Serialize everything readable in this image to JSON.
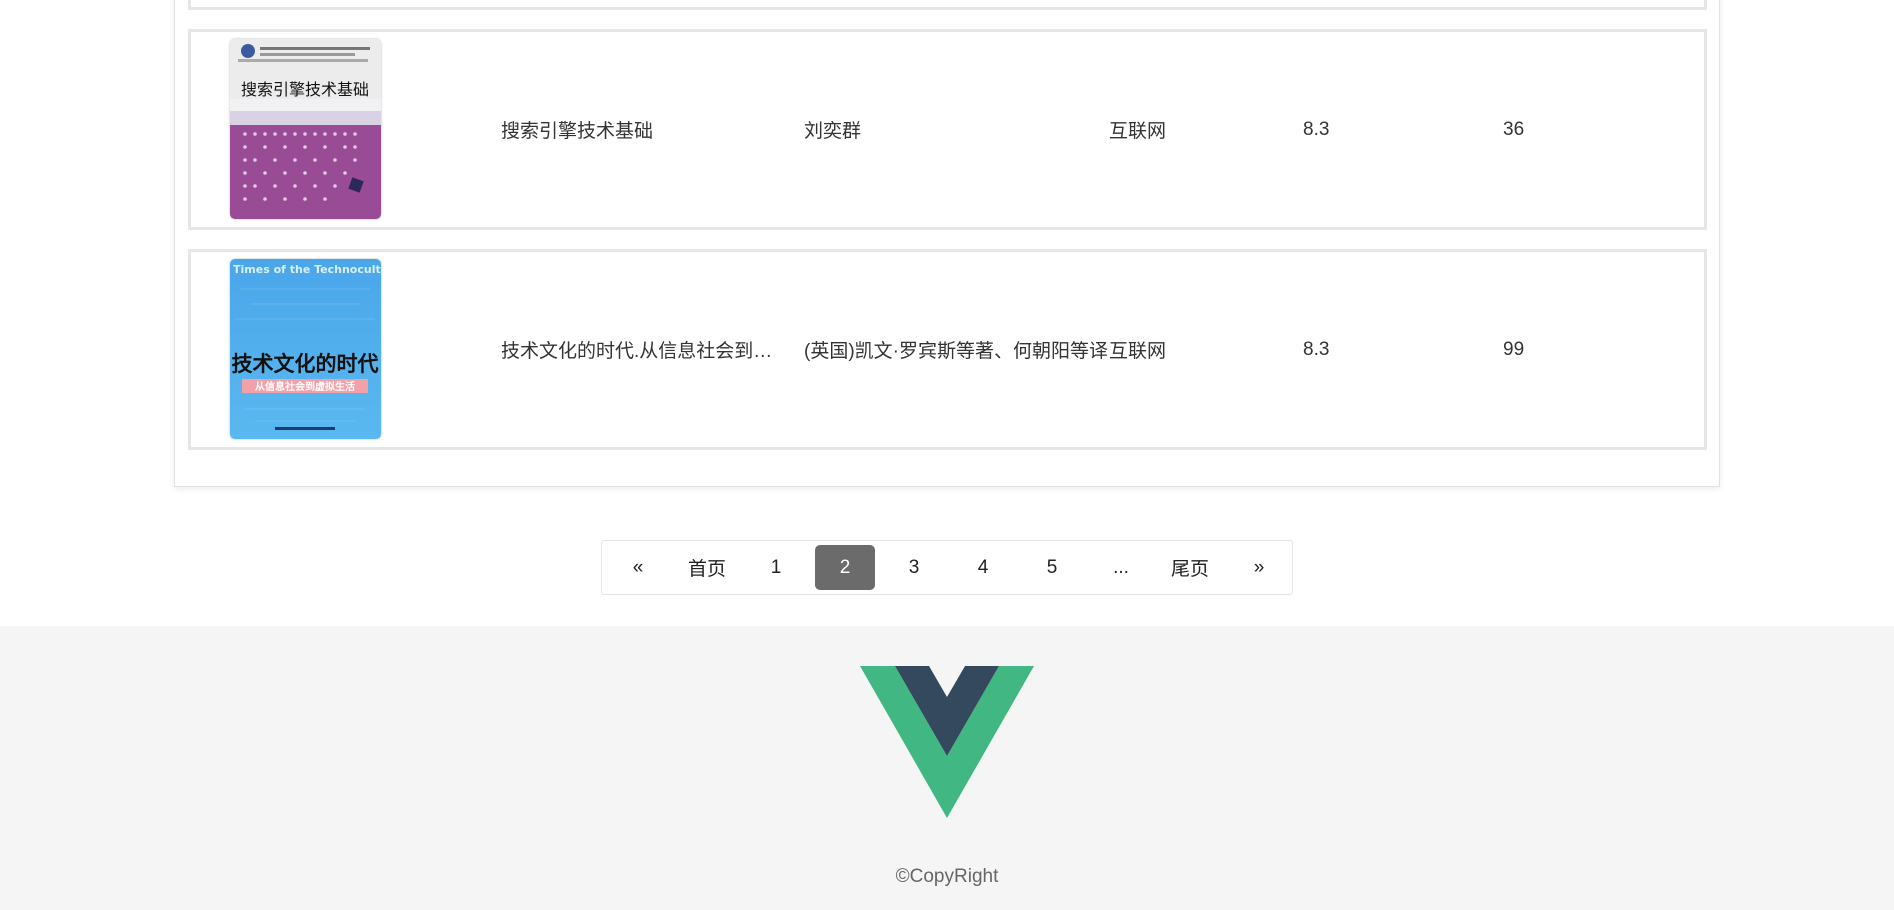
{
  "books": [
    {
      "cover_text": "搜索引擎技术基础",
      "title": "搜索引擎技术基础",
      "author": "刘奕群",
      "category": "互联网",
      "score": "8.3",
      "count": "36"
    },
    {
      "cover_text": "技术文化的时代",
      "cover_subtitle": "Times of the Technoculture",
      "cover_banner": "从信息社会到虚拟生活",
      "title": "技术文化的时代.从信息社会到虚拟...",
      "author": "(英国)凯文·罗宾斯等著、何朝阳等译",
      "category": "互联网",
      "score": "8.3",
      "count": "99"
    }
  ],
  "pagination": {
    "prev": "«",
    "first": "首页",
    "pages": [
      "1",
      "2",
      "3",
      "4",
      "5"
    ],
    "current": "2",
    "ellipsis": "...",
    "last": "尾页",
    "next": "»"
  },
  "footer": {
    "logo": "vue-logo",
    "copyright": "©CopyRight"
  },
  "colors": {
    "vue_green": "#41b883",
    "vue_dark": "#35495e",
    "active_page": "#6b6b6b",
    "footer_bg": "#f5f5f5"
  }
}
